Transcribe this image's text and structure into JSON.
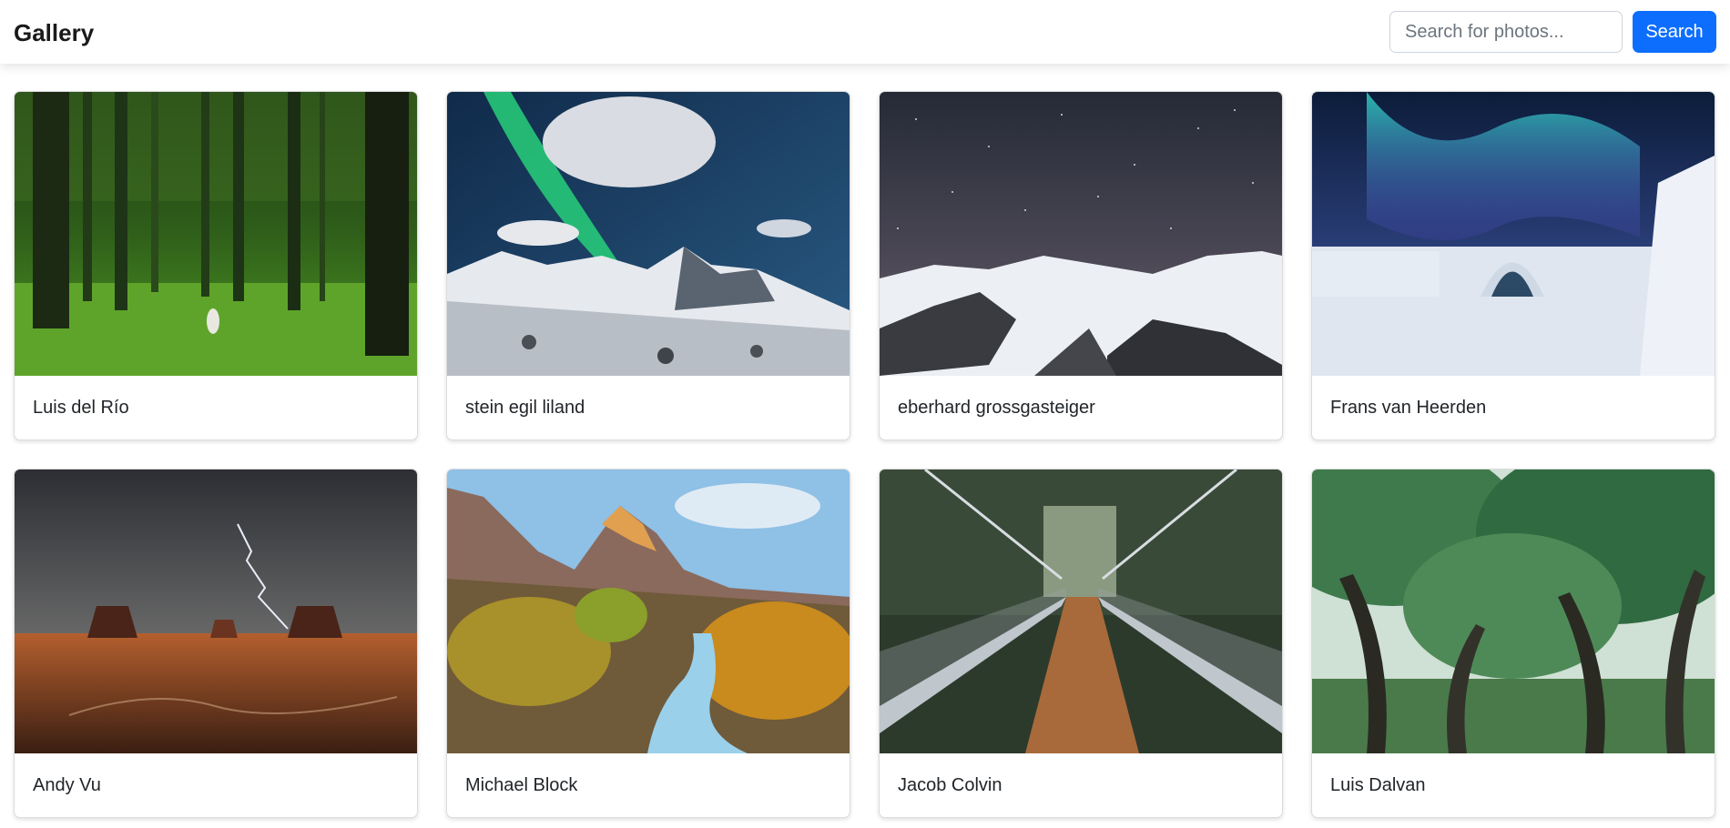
{
  "header": {
    "brand": "Gallery",
    "search_placeholder": "Search for photos...",
    "search_value": "",
    "search_button_label": "Search"
  },
  "photos": [
    {
      "author": "Luis del Río",
      "icon": "forest-photo"
    },
    {
      "author": "stein egil liland",
      "icon": "aurora-mountains-photo"
    },
    {
      "author": "eberhard grossgasteiger",
      "icon": "starry-snow-mountains-photo"
    },
    {
      "author": "Frans van Heerden",
      "icon": "aurora-ice-hotel-photo"
    },
    {
      "author": "Andy Vu",
      "icon": "desert-lightning-photo"
    },
    {
      "author": "Michael Block",
      "icon": "canyon-river-photo"
    },
    {
      "author": "Jacob Colvin",
      "icon": "suspension-bridge-photo"
    },
    {
      "author": "Luis Dalvan",
      "icon": "tree-canopy-photo"
    }
  ],
  "colors": {
    "accent": "#0d6efd",
    "text": "#212529",
    "border": "#dcdcdc"
  }
}
